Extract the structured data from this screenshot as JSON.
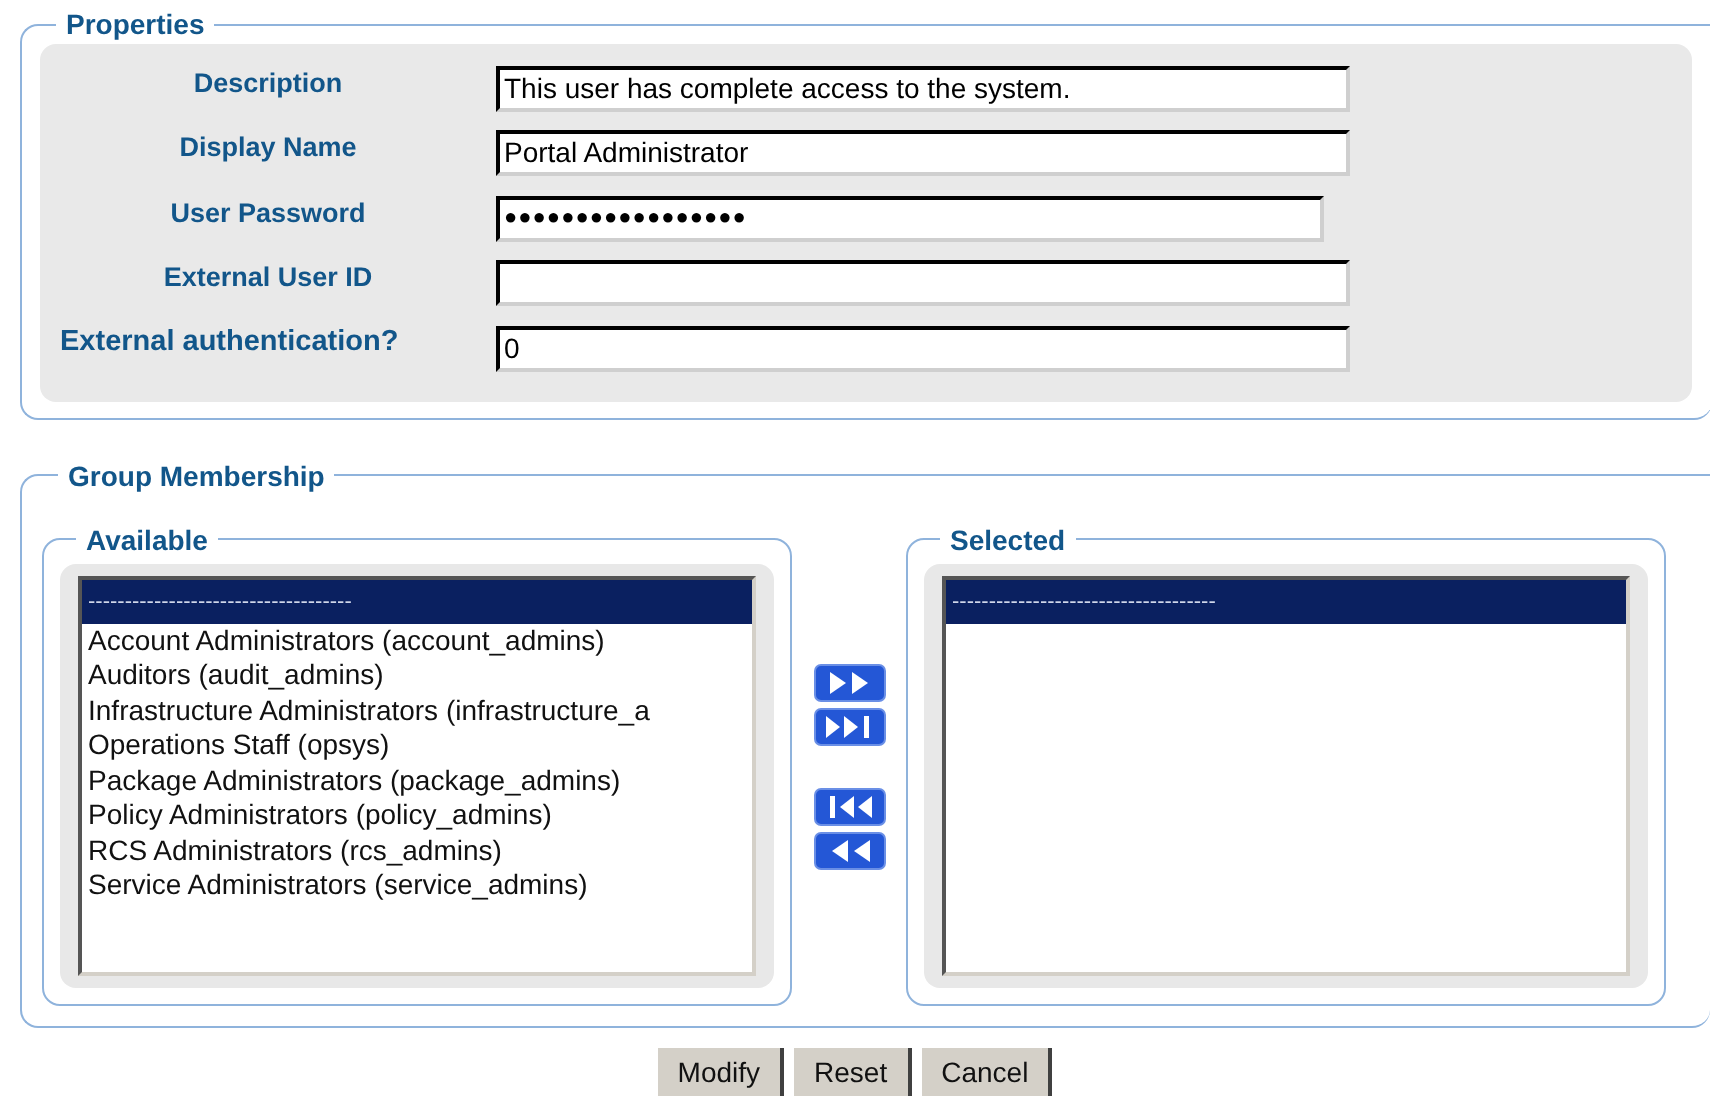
{
  "properties": {
    "legend": "Properties",
    "fields": [
      {
        "label": "Description",
        "value": "This user has complete access to the system.",
        "kind": "text"
      },
      {
        "label": "Display Name",
        "value": "Portal Administrator",
        "kind": "text"
      },
      {
        "label": "User Password",
        "value": "●●●●●●●●●●●●●●●●●",
        "kind": "password"
      },
      {
        "label": "External User ID",
        "kind": "text"
      },
      {
        "label": "External authentication?",
        "value": "0",
        "kind": "text"
      }
    ]
  },
  "group_membership": {
    "legend": "Group Membership",
    "available": {
      "legend": "Available",
      "items": [
        {
          "label": "------------------------------------",
          "selected": true
        },
        {
          "label": "Account Administrators (account_admins)",
          "selected": false
        },
        {
          "label": "Auditors (audit_admins)",
          "selected": false
        },
        {
          "label": "Infrastructure Administrators (infrastructure_a",
          "selected": false
        },
        {
          "label": "Operations Staff (opsys)",
          "selected": false
        },
        {
          "label": "Package Administrators (package_admins)",
          "selected": false
        },
        {
          "label": "Policy Administrators (policy_admins)",
          "selected": false
        },
        {
          "label": "RCS Administrators (rcs_admins)",
          "selected": false
        },
        {
          "label": "Service Administrators (service_admins)",
          "selected": false
        }
      ]
    },
    "selected": {
      "legend": "Selected",
      "items": [
        {
          "label": "------------------------------------",
          "selected": true
        }
      ]
    }
  },
  "buttons": [
    "Modify",
    "Reset",
    "Cancel"
  ]
}
